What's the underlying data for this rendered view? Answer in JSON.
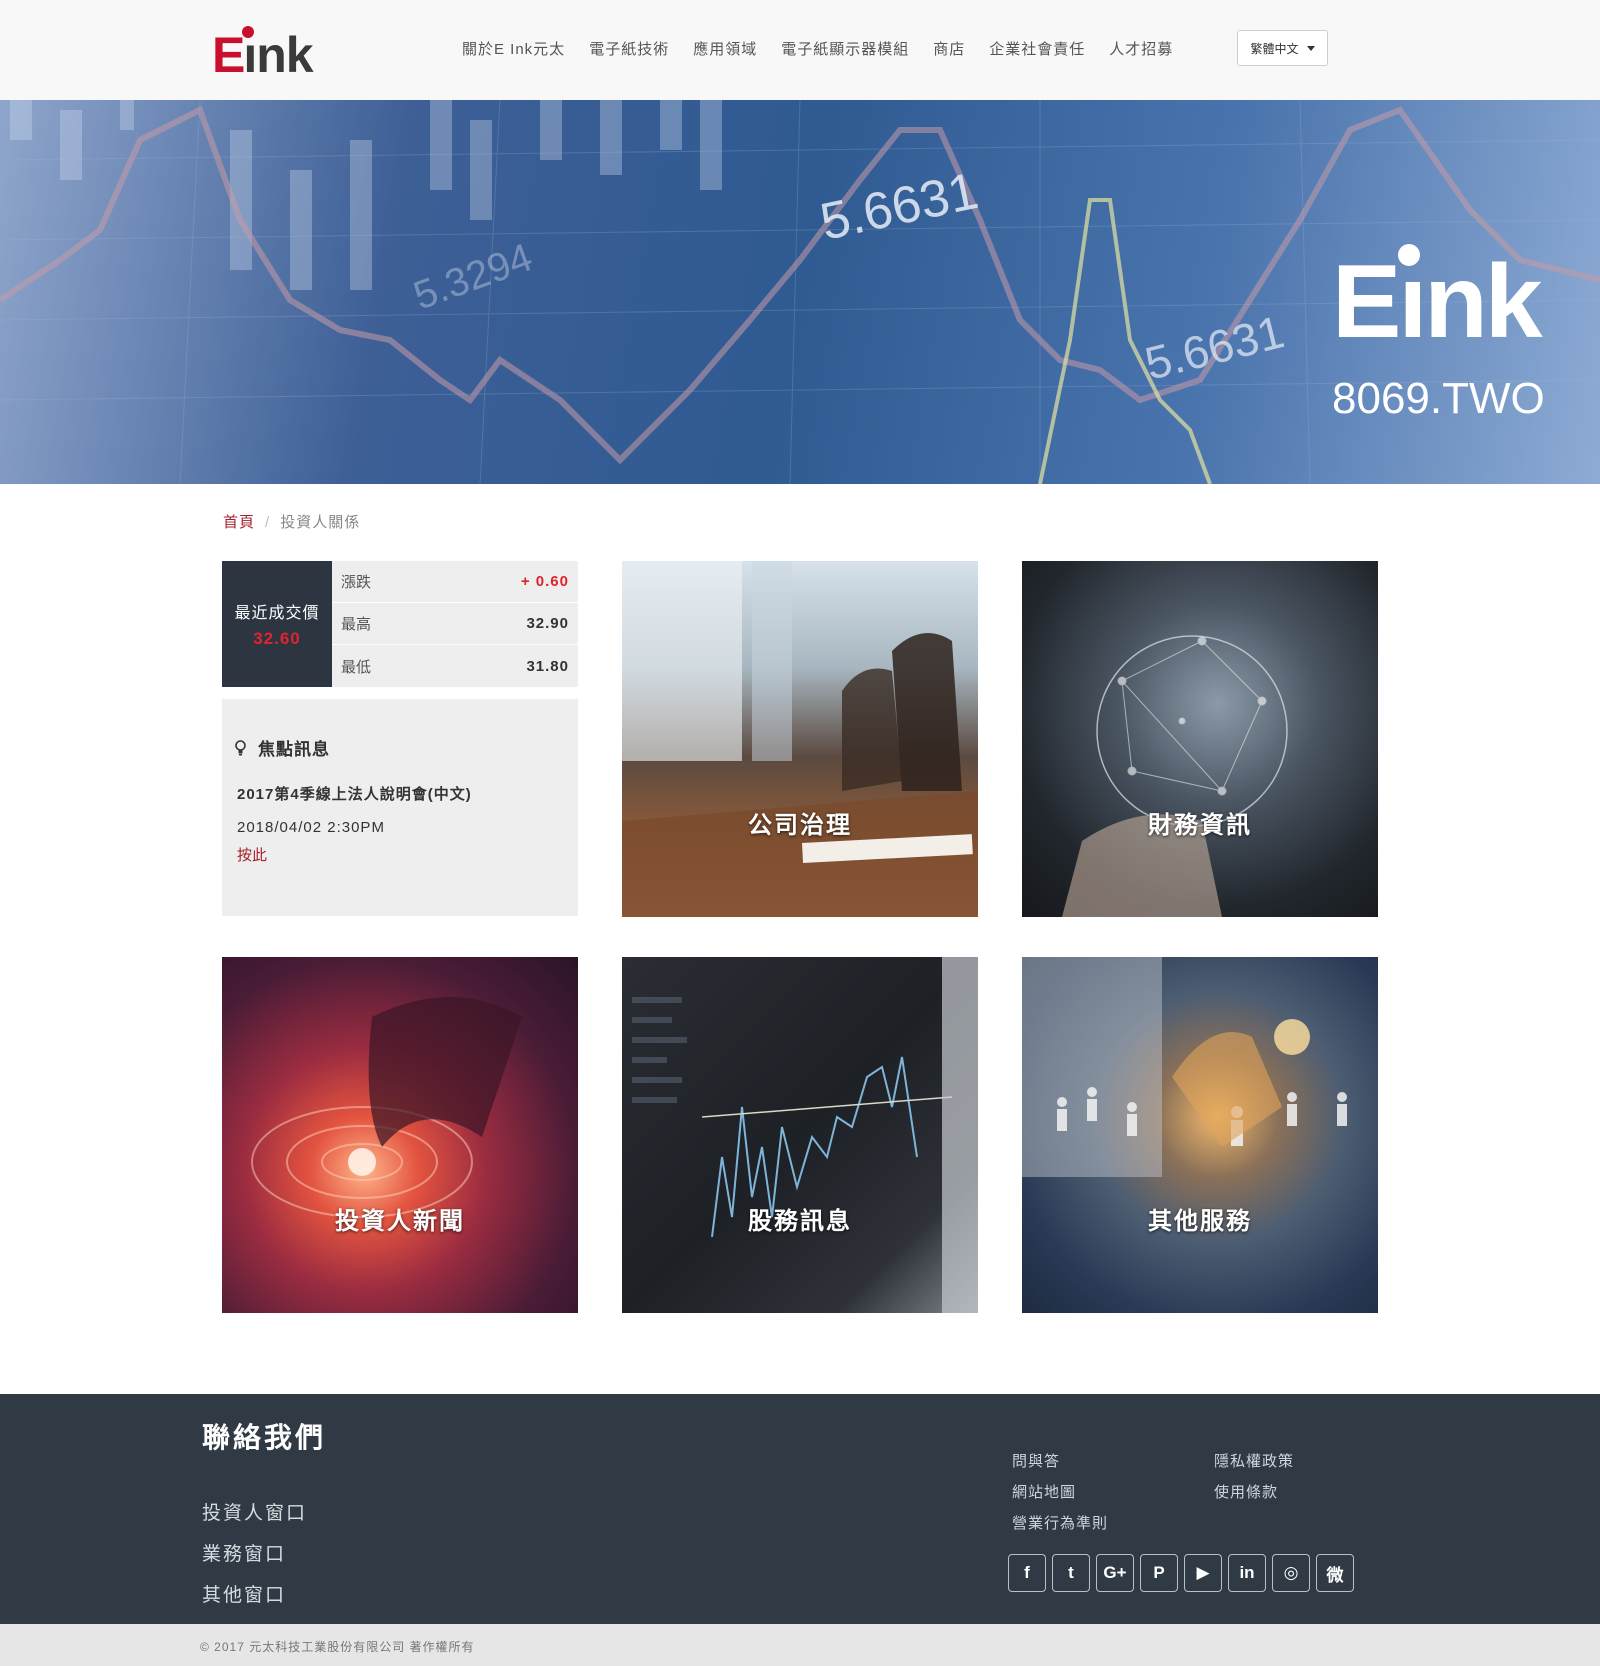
{
  "header": {
    "logo_text": "Eink",
    "nav": [
      "關於E Ink元太",
      "電子紙技術",
      "應用領域",
      "電子紙顯示器模組",
      "商店",
      "企業社會責任",
      "人才招募"
    ],
    "language": "繁體中文"
  },
  "banner": {
    "logo_text": "Eink",
    "stock_code": "8069.TWO",
    "overlay_numbers": [
      "5.6631",
      "5.3294",
      "5.6631"
    ]
  },
  "breadcrumb": {
    "home": "首頁",
    "separator": "/",
    "current": "投資人關係"
  },
  "quote": {
    "label": "最近成交價",
    "price": "32.60",
    "rows": [
      {
        "key": "漲跌",
        "value": "+ 0.60"
      },
      {
        "key": "最高",
        "value": "32.90"
      },
      {
        "key": "最低",
        "value": "31.80"
      }
    ]
  },
  "focus": {
    "heading": "焦點訊息",
    "title": "2017第4季線上法人說明會(中文)",
    "date": "2018/04/02 2:30PM",
    "link": "按此"
  },
  "tiles": [
    "公司治理",
    "財務資訊",
    "投資人新聞",
    "股務訊息",
    "其他服務"
  ],
  "footer": {
    "contact_title": "聯絡我們",
    "contacts": [
      "投資人窗口",
      "業務窗口",
      "其他窗口"
    ],
    "links": [
      "問與答",
      "隱私權政策",
      "網站地圖",
      "使用條款",
      "營業行為準則"
    ],
    "social": [
      {
        "icon": "facebook-icon",
        "glyph": "f"
      },
      {
        "icon": "twitter-icon",
        "glyph": "t"
      },
      {
        "icon": "google-plus-icon",
        "glyph": "G+"
      },
      {
        "icon": "pinterest-icon",
        "glyph": "P"
      },
      {
        "icon": "youtube-icon",
        "glyph": "▶"
      },
      {
        "icon": "linkedin-icon",
        "glyph": "in"
      },
      {
        "icon": "instagram-icon",
        "glyph": "◎"
      },
      {
        "icon": "weibo-icon",
        "glyph": "微"
      }
    ],
    "copyright": "© 2017 元太科技工業股份有限公司 著作權所有"
  },
  "colors": {
    "brand_red": "#c8102e",
    "up_red": "#e0242f",
    "dark_panel": "#2d3640",
    "footer_bg": "#2f3a45"
  }
}
